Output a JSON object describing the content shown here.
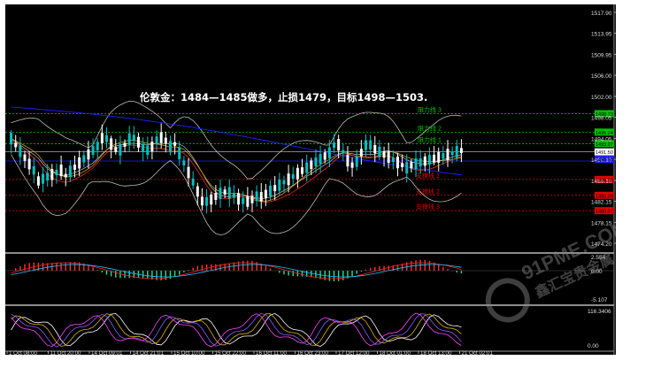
{
  "annotation": "伦敦金：1484—1485做多，止损1479，目标1498—1503.",
  "watermark": {
    "text": "91PME.COM",
    "subtext": "鑫汇宝贵金属"
  },
  "price_axis": [
    "1517.90",
    "1513.95",
    "1509.95",
    "1506.00",
    "1502.00",
    "1498.05",
    "1494.05",
    "1490.10",
    "1486.10",
    "1482.15",
    "1478.15",
    "1474.20"
  ],
  "price_tags": {
    "r3": "1498.73",
    "r2": "1495.24",
    "r1": "1493.07",
    "last": "1491.50",
    "blue": "1490.10",
    "s1": "1486.28",
    "s2": "1483.28",
    "s3": "1480.37"
  },
  "levels": {
    "r3": "阻力线 3",
    "r2": "阻力线 2",
    "r1": "阻力线 1",
    "s1": "支撑线 1",
    "s2": "支撑线 2",
    "s3": "支撑线 3"
  },
  "macd_axis": [
    "2.554",
    "0.00",
    "-5.107"
  ],
  "osc_axis": [
    "116.3406",
    "0.00"
  ],
  "time_axis": [
    "1 Oct 08:00",
    "11 Oct 20:00",
    "14 Oct 09:01",
    "14 Oct 21:01",
    "15 Oct 10:00",
    "15 Oct 22:00",
    "16 Oct 11:00",
    "16 Oct 23:00",
    "17 Oct 12:00",
    "18 Oct 01:00",
    "18 Oct 13:00",
    "21 Oct 02:01"
  ],
  "colors": {
    "bg": "#000000",
    "bull": "#ffffff",
    "bear": "#00c0c0",
    "resist": "#00c000",
    "support": "#e00000",
    "ma_blue": "#2020ff"
  }
}
